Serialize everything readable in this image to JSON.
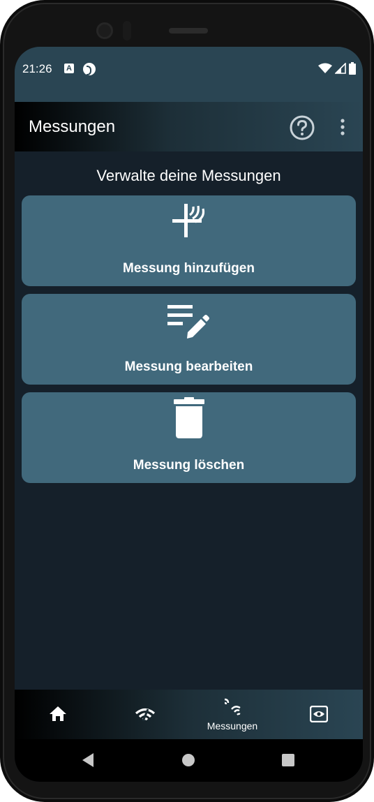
{
  "status_bar": {
    "time": "21:26",
    "left_icons": [
      "font-a-icon",
      "data-saver-icon"
    ],
    "right_icons": [
      "wifi-icon",
      "cell-signal-icon",
      "battery-icon"
    ]
  },
  "app_bar": {
    "title": "Messungen",
    "actions": [
      "help-circle-icon",
      "more-vert-icon"
    ]
  },
  "main": {
    "heading": "Verwalte deine Messungen",
    "cards": [
      {
        "label": "Messung hinzufügen",
        "icon": "add-measurement-icon"
      },
      {
        "label": "Messung bearbeiten",
        "icon": "edit-list-icon"
      },
      {
        "label": "Messung löschen",
        "icon": "trash-icon"
      }
    ]
  },
  "bottom_nav": {
    "items": [
      {
        "icon": "home-icon",
        "label": ""
      },
      {
        "icon": "wifi-signal-icon",
        "label": ""
      },
      {
        "icon": "signal-waves-icon",
        "label": "Messungen",
        "active": true
      },
      {
        "icon": "eye-view-icon",
        "label": ""
      }
    ]
  },
  "system_nav": [
    "back-icon",
    "home-circle-icon",
    "recents-icon"
  ],
  "colors": {
    "status_bar": "#2a4553",
    "background": "#15202a",
    "card": "#41697c",
    "text": "#ffffff"
  }
}
